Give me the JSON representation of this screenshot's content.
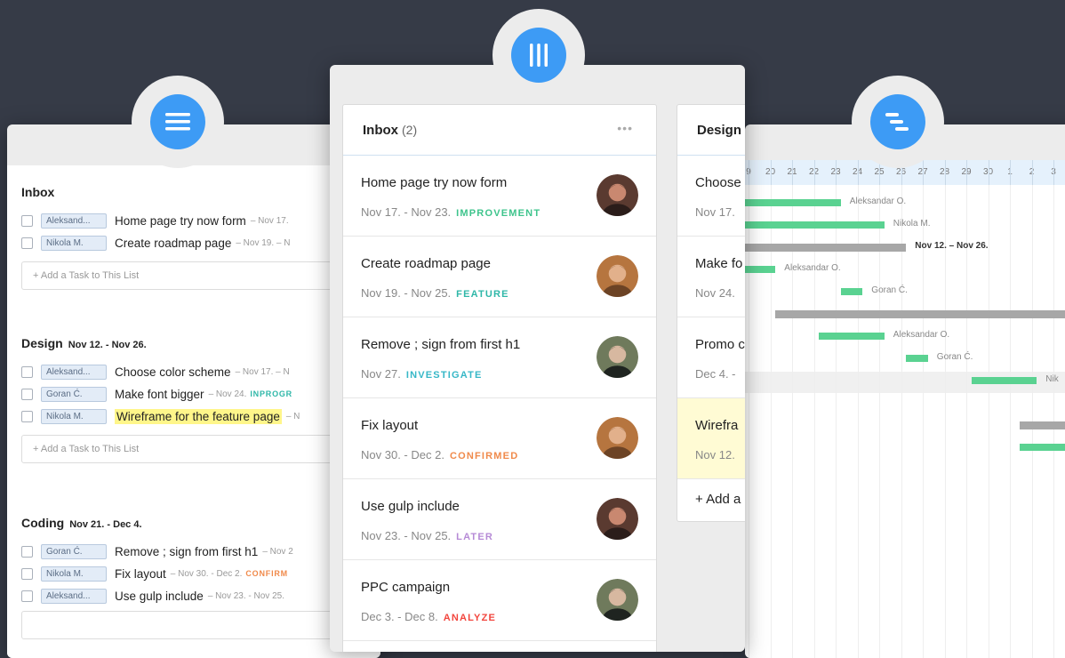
{
  "colors": {
    "background": "#363b47",
    "accent": "#3d9bf5",
    "gantt_bar": "#5ad291",
    "group_bar": "#a7a7a7",
    "highlight": "#fff68a",
    "tag_improvement": "#3ec48c",
    "tag_feature": "#2fb7a8",
    "tag_investigate": "#36b7c7",
    "tag_confirmed": "#f08a4b",
    "tag_later": "#b68ad6",
    "tag_analyze": "#f2453d"
  },
  "icons": {
    "list_view": "hamburger-menu-icon",
    "board_view": "columns-icon",
    "gantt_view": "gantt-bars-icon"
  },
  "list_view": {
    "sections": [
      {
        "title": "Inbox",
        "dates": "",
        "tasks": [
          {
            "assignee": "Aleksand...",
            "name": "Home page try now form",
            "meta": "– Nov 17.",
            "tag": "",
            "highlight": false
          },
          {
            "assignee": "Nikola M.",
            "name": "Create roadmap page",
            "meta": "– Nov 19. – N",
            "tag": "",
            "highlight": false
          }
        ],
        "add_label": "+ Add a Task to This List"
      },
      {
        "title": "Design",
        "dates": "Nov 12. - Nov 26.",
        "tasks": [
          {
            "assignee": "Aleksand...",
            "name": "Choose color scheme",
            "meta": "– Nov 17. – N",
            "tag": "",
            "highlight": false
          },
          {
            "assignee": "Goran Ć.",
            "name": "Make font bigger",
            "meta": "– Nov 24.",
            "tag": "INPROGR",
            "highlight": false
          },
          {
            "assignee": "Nikola M.",
            "name": "Wireframe for the feature page",
            "meta": "– N",
            "tag": "",
            "highlight": true
          }
        ],
        "add_label": "+ Add a Task to This List"
      },
      {
        "title": "Coding",
        "dates": "Nov 21. - Dec 4.",
        "tasks": [
          {
            "assignee": "Goran Ć.",
            "name": "Remove ; sign from first h1",
            "meta": "– Nov 2",
            "tag": "",
            "highlight": false
          },
          {
            "assignee": "Nikola M.",
            "name": "Fix layout",
            "meta": "– Nov 30. - Dec 2.",
            "tag": "CONFIRM",
            "highlight": false
          },
          {
            "assignee": "Aleksand...",
            "name": "Use gulp include",
            "meta": "– Nov 23. - Nov 25.",
            "tag": "",
            "highlight": false
          }
        ],
        "add_label": ""
      }
    ]
  },
  "board_view": {
    "columns": [
      {
        "title": "Inbox",
        "count": "(2)",
        "menu": "•••",
        "cards": [
          {
            "title": "Home page try now form",
            "dates": "Nov 17. - Nov 23.",
            "tag": "IMPROVEMENT",
            "tag_color": "#3ec48c",
            "avatar": "avatar-1",
            "highlight": false
          },
          {
            "title": "Create roadmap page",
            "dates": "Nov 19. - Nov 25.",
            "tag": "FEATURE",
            "tag_color": "#2fb7a8",
            "avatar": "avatar-2",
            "highlight": false
          },
          {
            "title": "Remove ; sign from first h1",
            "dates": "Nov 27.",
            "tag": "INVESTIGATE",
            "tag_color": "#36b7c7",
            "avatar": "avatar-3",
            "highlight": false
          },
          {
            "title": "Fix layout",
            "dates": "Nov 30. - Dec 2.",
            "tag": "CONFIRMED",
            "tag_color": "#f08a4b",
            "avatar": "avatar-2",
            "highlight": false
          },
          {
            "title": "Use gulp include",
            "dates": "Nov 23. - Nov 25.",
            "tag": "LATER",
            "tag_color": "#b68ad6",
            "avatar": "avatar-1",
            "highlight": false
          },
          {
            "title": "PPC campaign",
            "dates": "Dec 3. - Dec 8.",
            "tag": "ANALYZE",
            "tag_color": "#f2453d",
            "avatar": "avatar-3",
            "highlight": false
          }
        ],
        "add_label": ""
      },
      {
        "title": "Design",
        "count": "",
        "menu": "",
        "cards": [
          {
            "title": "Choose",
            "dates": "Nov 17.",
            "tag": "",
            "tag_color": "",
            "avatar": "",
            "highlight": false
          },
          {
            "title": "Make fo",
            "dates": "Nov 24.",
            "tag": "",
            "tag_color": "",
            "avatar": "",
            "highlight": false
          },
          {
            "title": "Promo c",
            "dates": "Dec 4. -",
            "tag": "",
            "tag_color": "",
            "avatar": "",
            "highlight": false
          },
          {
            "title": "Wirefra",
            "dates": "Nov 12.",
            "tag": "",
            "tag_color": "",
            "avatar": "",
            "highlight": true
          }
        ],
        "add_label": "+ Add a"
      }
    ]
  },
  "gantt_view": {
    "days": [
      "9",
      "20",
      "21",
      "22",
      "23",
      "24",
      "25",
      "26",
      "27",
      "28",
      "29",
      "30",
      "1",
      "2",
      "3"
    ],
    "bars": [
      {
        "type": "task",
        "label": "Aleksandar O.",
        "row": 0,
        "start": 0,
        "end": 4.4
      },
      {
        "type": "task",
        "label": "Nikola M.",
        "row": 1,
        "start": 0,
        "end": 6.4
      },
      {
        "type": "group",
        "label": "Nov 12. – Nov 26.",
        "row": 2,
        "start": 0,
        "end": 7.4
      },
      {
        "type": "task",
        "label": "Aleksandar O.",
        "row": 3,
        "start": 0,
        "end": 1.4
      },
      {
        "type": "task",
        "label": "Goran Ć.",
        "row": 4,
        "start": 4.4,
        "end": 5.4
      },
      {
        "type": "group",
        "label": "",
        "row": 5,
        "start": 1.4,
        "end": 15
      },
      {
        "type": "task",
        "label": "Aleksandar O.",
        "row": 6,
        "start": 3.4,
        "end": 6.4
      },
      {
        "type": "task",
        "label": "Goran Ć.",
        "row": 7,
        "start": 7.4,
        "end": 8.4
      },
      {
        "type": "task",
        "label": "Nik",
        "row": 8,
        "start": 10.4,
        "end": 13.4
      },
      {
        "type": "group",
        "label": "",
        "row": 10,
        "start": 12.6,
        "end": 15
      },
      {
        "type": "task",
        "label": "",
        "row": 11,
        "start": 12.6,
        "end": 15
      }
    ]
  }
}
